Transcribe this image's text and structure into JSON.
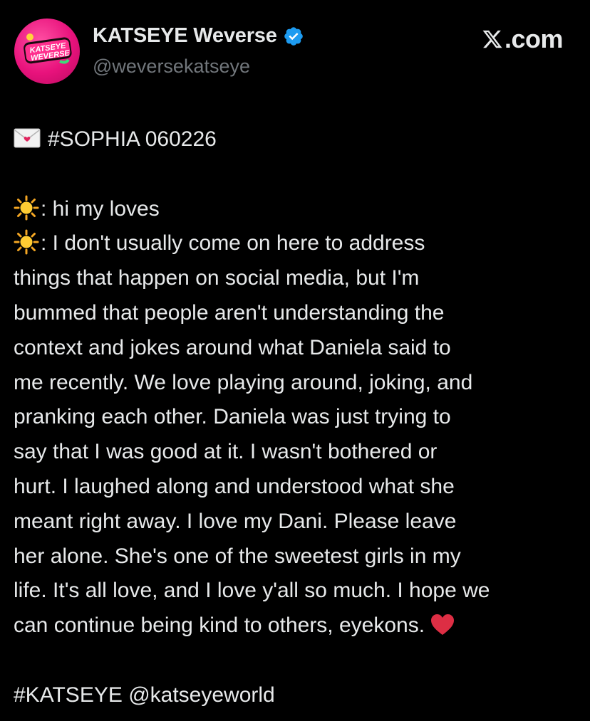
{
  "header": {
    "avatar_text": "KATSEYE WEVERSE",
    "display_name": "KATSEYE Weverse",
    "handle": "@weversekatseye",
    "site_label": ".com",
    "site_logo": "x-logo-icon",
    "verified_icon": "verified-badge-icon",
    "colors": {
      "verified": "#1d9bf0",
      "avatar": "#e8127c"
    }
  },
  "post": {
    "headline_icon": "love-letter-icon",
    "headline": "#SOPHIA 060226",
    "speaker_icon": "sun-icon",
    "line1": ": hi my loves",
    "lines": [
      ": I don't usually come on here to address",
      "things that happen on social media, but I'm",
      "bummed that people aren't understanding the",
      "context and jokes around what Daniela said to",
      "me recently. We love playing around, joking, and",
      "pranking each other. Daniela was just trying to",
      "say that I was good at it. I wasn't bothered or",
      "hurt. I laughed along and understood what she",
      "meant right away. I love my Dani. Please leave",
      "her alone. She's one of the sweetest girls in my",
      "life. It's all love, and I love y'all so much. I hope we",
      "can continue being kind to others, eyekons."
    ],
    "end_icon": "red-heart-icon",
    "footer_hashtag": "#KATSEYE",
    "footer_mention": "@katseyeworld"
  }
}
